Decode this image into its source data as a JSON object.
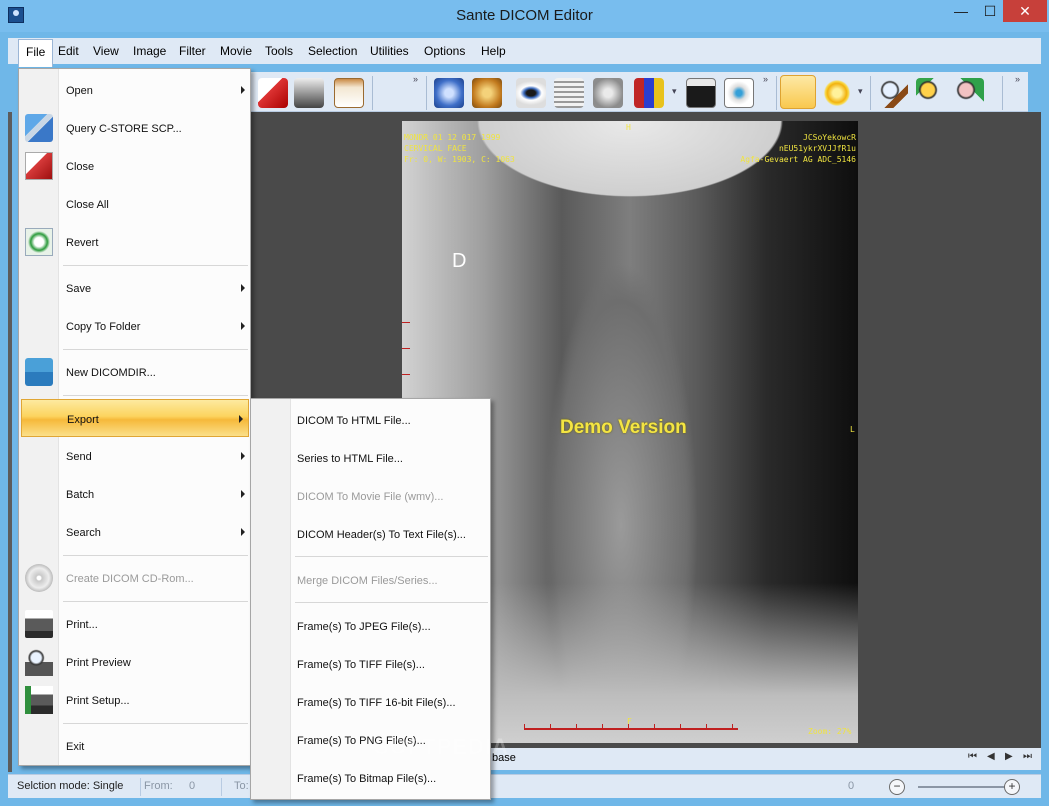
{
  "window": {
    "title": "Sante DICOM Editor",
    "min": "—",
    "max": "☐",
    "close": "✕"
  },
  "menubar": [
    "File",
    "Edit",
    "View",
    "Image",
    "Filter",
    "Movie",
    "Tools",
    "Selection",
    "Utilities",
    "Options",
    "Help"
  ],
  "file_menu": [
    {
      "label": "Open",
      "submenu": true,
      "icon": ""
    },
    {
      "label": "Query C-STORE SCP...",
      "icon": "network-computers-icon"
    },
    {
      "label": "Close",
      "icon": "close-file-icon"
    },
    {
      "label": "Close All",
      "icon": ""
    },
    {
      "label": "Revert",
      "icon": "revert-icon"
    },
    {
      "label": "Save",
      "submenu": true,
      "icon": ""
    },
    {
      "label": "Copy To Folder",
      "submenu": true,
      "icon": ""
    },
    {
      "label": "New DICOMDIR...",
      "icon": "folder-check-icon"
    },
    {
      "label": "Export",
      "submenu": true,
      "icon": "",
      "active": true
    },
    {
      "label": "Send",
      "submenu": true,
      "icon": ""
    },
    {
      "label": "Batch",
      "submenu": true,
      "icon": ""
    },
    {
      "label": "Search",
      "submenu": true,
      "icon": ""
    },
    {
      "label": "Create DICOM CD-Rom...",
      "icon": "cd-icon",
      "disabled": true
    },
    {
      "label": "Print...",
      "icon": "printer-icon"
    },
    {
      "label": "Print Preview",
      "icon": "print-preview-icon"
    },
    {
      "label": "Print Setup...",
      "icon": "print-setup-icon"
    },
    {
      "label": "Exit",
      "icon": ""
    }
  ],
  "export_menu": [
    {
      "label": "DICOM To HTML File..."
    },
    {
      "label": "Series to HTML File..."
    },
    {
      "label": "DICOM To Movie File (wmv)...",
      "disabled": true
    },
    {
      "label": "DICOM Header(s) To Text File(s)..."
    },
    {
      "label": "Merge DICOM Files/Series...",
      "disabled": true
    },
    {
      "label": "Frame(s) To JPEG File(s)..."
    },
    {
      "label": "Frame(s) To TIFF File(s)..."
    },
    {
      "label": "Frame(s) To TIFF 16-bit File(s)..."
    },
    {
      "label": "Frame(s) To PNG File(s)..."
    },
    {
      "label": "Frame(s) To Bitmap File(s)..."
    }
  ],
  "viewer": {
    "overlay_tl": [
      "MONDR 01 12 017 1999",
      "CERVICAL FACE",
      "Fr: 0, W: 1903, C: 1063"
    ],
    "overlay_tr": [
      "JCSoYekowcR",
      "nEU51ykrXVJJfR1u",
      "Agfa-Gevaert AG ADC_5146"
    ],
    "top_marker": "H",
    "bottom_marker": "F",
    "left_marker": "L",
    "image_label": "D",
    "demo_text": "Demo Version",
    "zoom_text": "Zoom: 27%"
  },
  "nav": {
    "text": "base",
    "first": "⏮",
    "prev": "◀",
    "next": "▶",
    "last": "⏭"
  },
  "status": {
    "mode": "Selction mode: Single",
    "from_label": "From:",
    "from_value": "0",
    "to_label": "To:",
    "right_value": "0",
    "zoom_minus": "−",
    "zoom_plus": "+"
  },
  "watermark": "SOFTPEDIA",
  "colors": {
    "title_bg": "#78bdee",
    "menu_highlight": "#fcd45f",
    "overlay_text": "#f0e440",
    "demo_text": "#f4e542"
  }
}
